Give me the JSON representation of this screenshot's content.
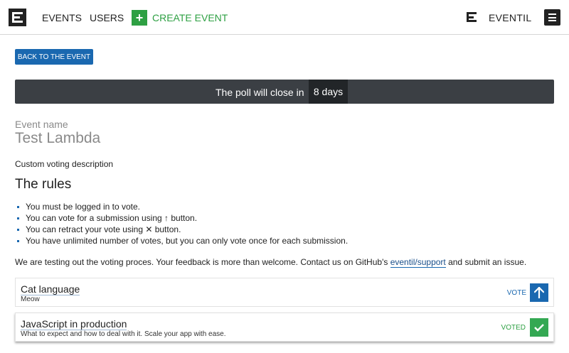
{
  "header": {
    "nav": {
      "events": "EVENTS",
      "users": "USERS",
      "create": "CREATE EVENT"
    },
    "brand": "EVENTIL",
    "icons": {
      "logo": "eventil-logo-icon",
      "plus": "plus-icon",
      "menu": "hamburger-menu-icon"
    }
  },
  "back_button": "BACK TO THE EVENT",
  "poll": {
    "text": "The poll will close in",
    "remaining": "8 days"
  },
  "event": {
    "label": "Event name",
    "name": "Test Lambda"
  },
  "custom_description": "Custom voting description",
  "rules": {
    "title": "The rules",
    "items": [
      "You must be logged in to vote.",
      "You can vote for a submission using ↑ button.",
      "You can retract your vote using ✕ button.",
      "You have unlimited number of votes, but you can only vote once for each submission."
    ]
  },
  "note": {
    "before": "We are testing out the voting proces. Your feedback is more than welcome. Contact us on GitHub's ",
    "link": "eventil/support",
    "after": " and submit an issue."
  },
  "submissions": [
    {
      "title": "Cat language",
      "description": "Meow",
      "action_label": "VOTE",
      "state": "not-voted"
    },
    {
      "title": "JavaScript in production",
      "description": "What to expect and how to deal with it. Scale your app with ease.",
      "action_label": "VOTED",
      "state": "voted"
    }
  ],
  "colors": {
    "primary": "#1a68b0",
    "success": "#2ea043",
    "dark": "#3b3f44"
  }
}
